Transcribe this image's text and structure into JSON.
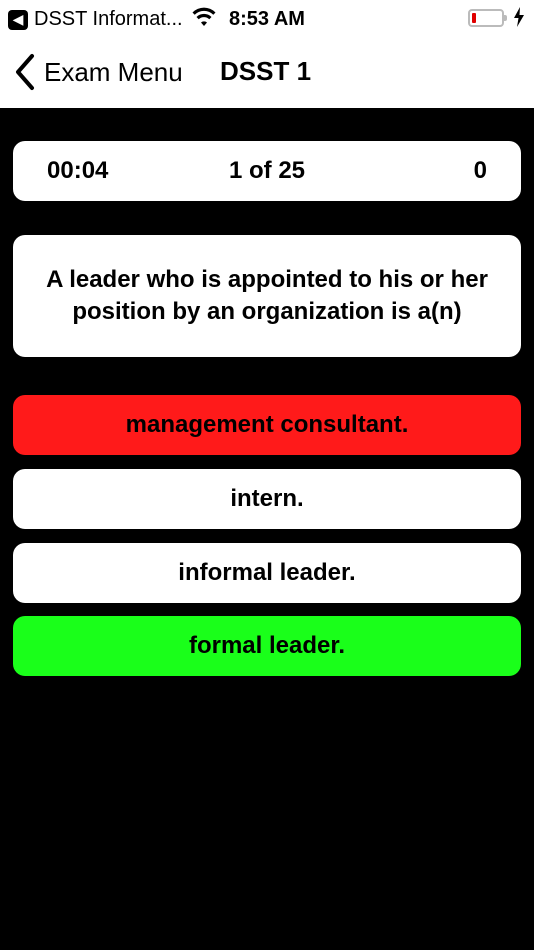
{
  "status_bar": {
    "back_app_label": "DSST Informat...",
    "time": "8:53 AM",
    "battery_color": "#e00000"
  },
  "nav": {
    "back_label": "Exam Menu",
    "title": "DSST 1"
  },
  "quiz_info": {
    "timer": "00:04",
    "progress": "1 of 25",
    "score": "0"
  },
  "question": {
    "text": "A leader who is appointed to his or her position by an organization is a(n)"
  },
  "answers": [
    {
      "label": "management consultant.",
      "color": "#ff1a1a",
      "state": "incorrect"
    },
    {
      "label": "intern.",
      "color": "#ffffff",
      "state": "neutral"
    },
    {
      "label": "informal leader.",
      "color": "#ffffff",
      "state": "neutral"
    },
    {
      "label": "formal leader.",
      "color": "#1aff1a",
      "state": "correct"
    }
  ]
}
